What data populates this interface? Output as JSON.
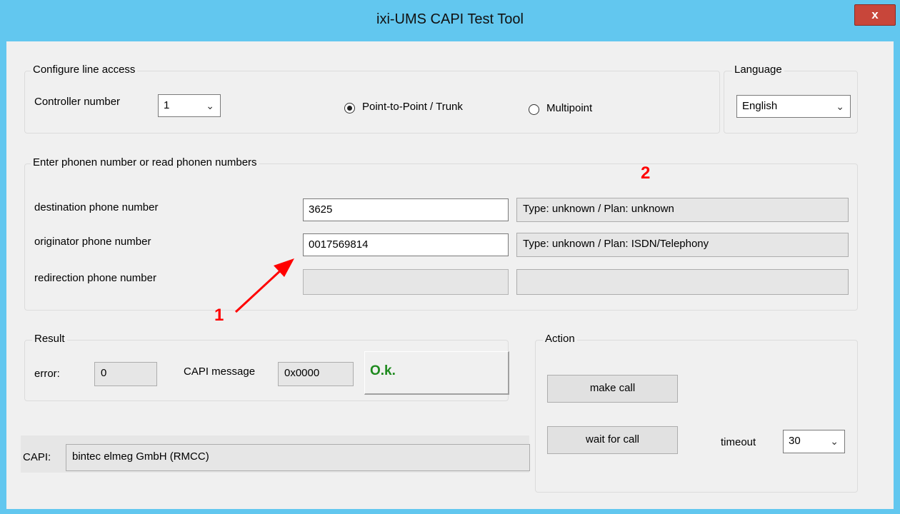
{
  "window": {
    "title": "ixi-UMS CAPI Test Tool",
    "close_label": "x"
  },
  "line_access": {
    "legend": "Configure line access",
    "controller_label": "Controller number",
    "controller_value": "1",
    "radio_ptp_label": "Point-to-Point / Trunk",
    "radio_ptp_selected": true,
    "radio_multi_label": "Multipoint",
    "radio_multi_selected": false
  },
  "language": {
    "legend": "Language",
    "value": "English"
  },
  "phone": {
    "legend": "Enter phonen number or read phonen numbers",
    "rows": [
      {
        "label": "destination phone number",
        "value": "3625",
        "info": "Type: unknown /  Plan: unknown"
      },
      {
        "label": "originator phone number",
        "value": "0017569814",
        "info": "Type: unknown / Plan: ISDN/Telephony"
      },
      {
        "label": "redirection phone number",
        "value": "",
        "info": ""
      }
    ]
  },
  "result": {
    "legend": "Result",
    "error_label": "error:",
    "error_value": "0",
    "capi_message_label": "CAPI message",
    "capi_message_value": "0x0000",
    "status_text": "O.k.",
    "status_color": "#1e8a1e"
  },
  "capi": {
    "label": "CAPI:",
    "value": "bintec elmeg GmbH (RMCC)"
  },
  "action": {
    "legend": "Action",
    "make_call_label": "make call",
    "wait_for_call_label": "wait for call",
    "timeout_label": "timeout",
    "timeout_value": "30"
  },
  "annotations": {
    "marker_1": "1",
    "marker_2": "2",
    "color": "#ff0000"
  }
}
